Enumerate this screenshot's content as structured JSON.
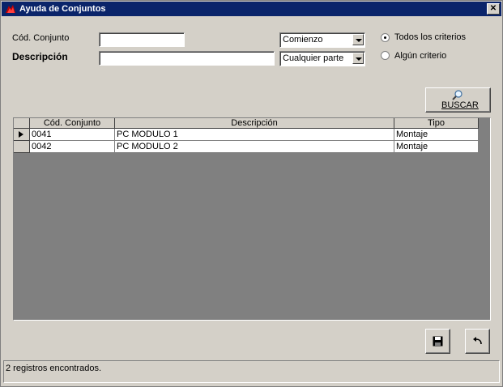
{
  "window": {
    "title": "Ayuda de Conjuntos",
    "close_glyph": "✕"
  },
  "filters": {
    "code_label": "Cód. Conjunto",
    "code_value": "",
    "code_match": "Comienzo",
    "desc_label": "Descripción",
    "desc_value": "",
    "desc_match": "Cualquier parte",
    "criteria": [
      {
        "label": "Todos los criterios",
        "checked": true
      },
      {
        "label": "Algún criterio",
        "checked": false
      }
    ],
    "search_button": "BUSCAR"
  },
  "table": {
    "columns": [
      "Cód. Conjunto",
      "Descripción",
      "Tipo"
    ],
    "rows": [
      {
        "code": "0041",
        "desc": "PC MODULO 1",
        "tipo": "Montaje",
        "current": true
      },
      {
        "code": "0042",
        "desc": "PC MODULO 2",
        "tipo": "Montaje",
        "current": false
      }
    ]
  },
  "status": {
    "text": "2 registros encontrados."
  },
  "icons": {
    "save": "save-icon",
    "undo": "undo-icon",
    "search": "magnifier-icon"
  },
  "colors": {
    "titlebar": "#0a246a",
    "face": "#d4d0c8"
  }
}
